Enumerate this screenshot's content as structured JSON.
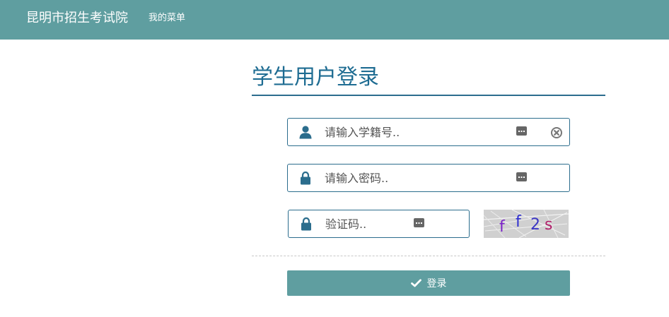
{
  "header": {
    "brand": "昆明市招生考试院",
    "menu_label": "我的菜单"
  },
  "login": {
    "title": "学生用户登录",
    "student_id_placeholder": "请输入学籍号..",
    "password_placeholder": "请输入密码..",
    "captcha_placeholder": "验证码..",
    "captcha_text": "ff2s",
    "submit_label": "登录"
  },
  "colors": {
    "header_bg": "#5f9ea0",
    "accent": "#1e6c92",
    "button_bg": "#5f9ea0"
  },
  "icons": {
    "student_id_field": "user-icon",
    "password_field": "lock-icon",
    "captcha_field": "lock-icon",
    "keyboard": "keyboard-icon",
    "clear": "clear-icon",
    "submit": "check-icon"
  }
}
